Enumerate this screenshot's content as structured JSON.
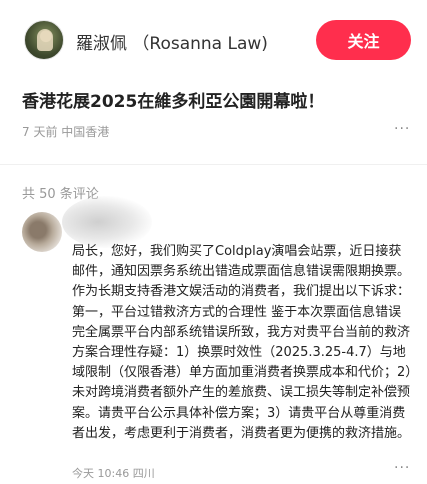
{
  "header": {
    "author_name": "羅淑佩 （Rosanna Law)",
    "follow_label": "关注"
  },
  "post": {
    "title": "香港花展2025在維多利亞公園開幕啦！",
    "meta": "7 天前 中国香港",
    "more": "···"
  },
  "comments": {
    "count_label": "共 50 条评论",
    "items": [
      {
        "text": "局长，您好，我们购买了Coldplay演唱会站票，近日接获邮件，通知因票务系统出错造成票面信息错误需限期换票。作为长期支持香港文娱活动的消费者，我们提出以下诉求：第一，平台过错救济方式的合理性 鉴于本次票面信息错误完全属票平台内部系统错误所致，我方对贵平台当前的救济方案合理性存疑：1）换票时效性（2025.3.25-4.7）与地域限制（仅限香港）单方面加重消费者换票成本和代价；2）未对跨境消费者额外产生的差旅费、误工损失等制定补偿预案。请贵平台公示具体补偿方案；3）请贵平台从尊重消费者出发，考虑更利于消费者，消费者更为便携的救济措施。",
        "meta": "今天 10:46 四川",
        "more": "···"
      }
    ]
  },
  "colors": {
    "accent": "#ff2e4d",
    "muted_text": "#999999"
  }
}
